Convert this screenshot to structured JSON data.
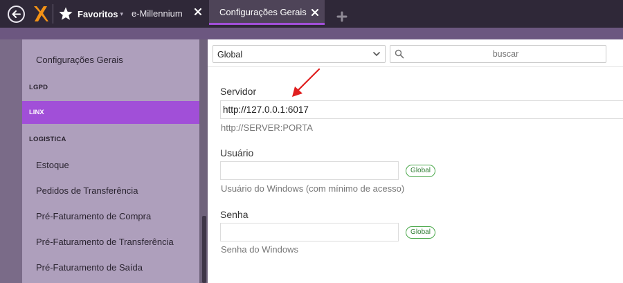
{
  "topbar": {
    "favorites_label": "Favoritos",
    "favorites_caret": "▾",
    "tabs": [
      {
        "label": "e-Millennium",
        "active": false
      },
      {
        "label": "Configurações Gerais",
        "active": true
      }
    ],
    "icons": [
      "back-arrow-icon",
      "logo-icon",
      "star-icon",
      "close-icon",
      "add-tab-icon"
    ]
  },
  "sidebar": {
    "items": [
      {
        "label": "Configurações Gerais",
        "type": "item"
      },
      {
        "label": "LGPD",
        "type": "header"
      },
      {
        "label": "LINX",
        "type": "header",
        "active": true
      },
      {
        "label": "LOGISTICA",
        "type": "header"
      },
      {
        "label": "Estoque",
        "type": "item"
      },
      {
        "label": "Pedidos de Transferência",
        "type": "item"
      },
      {
        "label": "Pré-Faturamento de Compra",
        "type": "item"
      },
      {
        "label": "Pré-Faturamento de Transferência",
        "type": "item"
      },
      {
        "label": "Pré-Faturamento de Saída",
        "type": "item"
      }
    ]
  },
  "toolbar": {
    "scope_select": "Global",
    "search_placeholder": "buscar"
  },
  "form": {
    "server": {
      "label": "Servidor",
      "value": "http://127.0.0.1:6017",
      "hint": "http://SERVER:PORTA"
    },
    "user": {
      "label": "Usuário",
      "value": "",
      "badge": "Global",
      "hint": "Usuário do Windows (com mínimo de acesso)"
    },
    "password": {
      "label": "Senha",
      "value": "",
      "badge": "Global",
      "hint": "Senha do Windows"
    }
  },
  "colors": {
    "topbar": "#2f2838",
    "accent": "#a14fd8",
    "annotation_arrow": "#e01f1f",
    "badge_border": "#4aa84a"
  }
}
